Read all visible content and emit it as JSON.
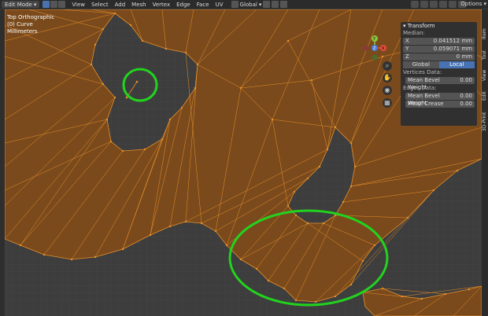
{
  "header": {
    "mode": "Edit Mode",
    "menus": [
      "View",
      "Select",
      "Add",
      "Mesh",
      "Vertex",
      "Edge",
      "Face",
      "UV"
    ],
    "transform_orientation": "Global",
    "options_label": "Options"
  },
  "viewport_info": {
    "line1": "Top Orthographic",
    "line2": "(0) Curve",
    "line3": "Millimeters"
  },
  "npanel": {
    "section": "Transform",
    "median_label": "Median:",
    "x_label": "X",
    "x_value": "0.041512 mm",
    "y_label": "Y",
    "y_value": "0.059071 mm",
    "z_label": "Z",
    "z_value": "0 mm",
    "global_label": "Global",
    "local_label": "Local",
    "vertices_data_label": "Vertices Data:",
    "v_bevel_label": "Mean Bevel Weight",
    "v_bevel_value": "0.00",
    "edges_data_label": "Edges Data:",
    "e_bevel_label": "Mean Bevel Weight",
    "e_bevel_value": "0.00",
    "crease_label": "Mean Crease",
    "crease_value": "0.00"
  },
  "side_tabs": [
    "Item",
    "Tool",
    "View",
    "Edit",
    "3D-Print"
  ],
  "gizmo": {
    "y_label": "Y",
    "x_label": "X",
    "z_label": "Z"
  },
  "colors": {
    "mesh_face": "#7a4a1c",
    "mesh_edge": "#e8902a",
    "background": "#3d3d3d",
    "highlight_circle": "#22d31e",
    "accent": "#4772b3"
  }
}
